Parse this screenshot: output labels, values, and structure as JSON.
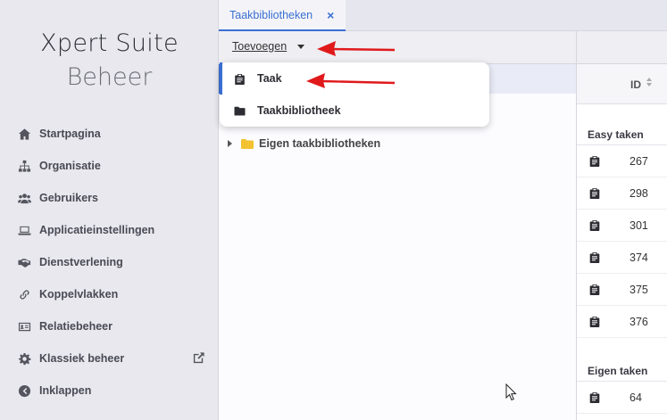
{
  "brand": {
    "line1": "Xpert Suite",
    "line2": "Beheer"
  },
  "sidebar": {
    "items": [
      {
        "label": "Startpagina",
        "icon": "home-icon"
      },
      {
        "label": "Organisatie",
        "icon": "sitemap-icon"
      },
      {
        "label": "Gebruikers",
        "icon": "users-icon"
      },
      {
        "label": "Applicatieinstellingen",
        "icon": "laptop-icon"
      },
      {
        "label": "Dienstverlening",
        "icon": "handshake-icon"
      },
      {
        "label": "Koppelvlakken",
        "icon": "link-icon"
      },
      {
        "label": "Relatiebeheer",
        "icon": "id-card-icon"
      },
      {
        "label": "Klassiek beheer",
        "icon": "gear-icon",
        "external": "external-link-icon"
      },
      {
        "label": "Inklappen",
        "icon": "chevron-left-circle-icon"
      }
    ]
  },
  "tabs": [
    {
      "label": "Taakbibliotheken",
      "close": "×"
    }
  ],
  "toolbar": {
    "add_label": "Toevoegen"
  },
  "dropdown": {
    "items": [
      {
        "label": "Taak",
        "icon": "clipboard-icon"
      },
      {
        "label": "Taakbibliotheek",
        "icon": "folder-icon"
      }
    ]
  },
  "tree": {
    "nodes": [
      {
        "label": "Eigen taakbibliotheken",
        "icon": "folder-icon"
      }
    ]
  },
  "table": {
    "column_id": "ID",
    "groups": [
      {
        "label": "Easy taken",
        "rows": [
          "267",
          "298",
          "301",
          "374",
          "375",
          "376"
        ]
      },
      {
        "label": "Eigen taken",
        "rows": [
          "64"
        ]
      }
    ]
  },
  "colors": {
    "accent": "#3a6fd1",
    "annotation": "#e0191b",
    "folder": "#f2c230"
  }
}
